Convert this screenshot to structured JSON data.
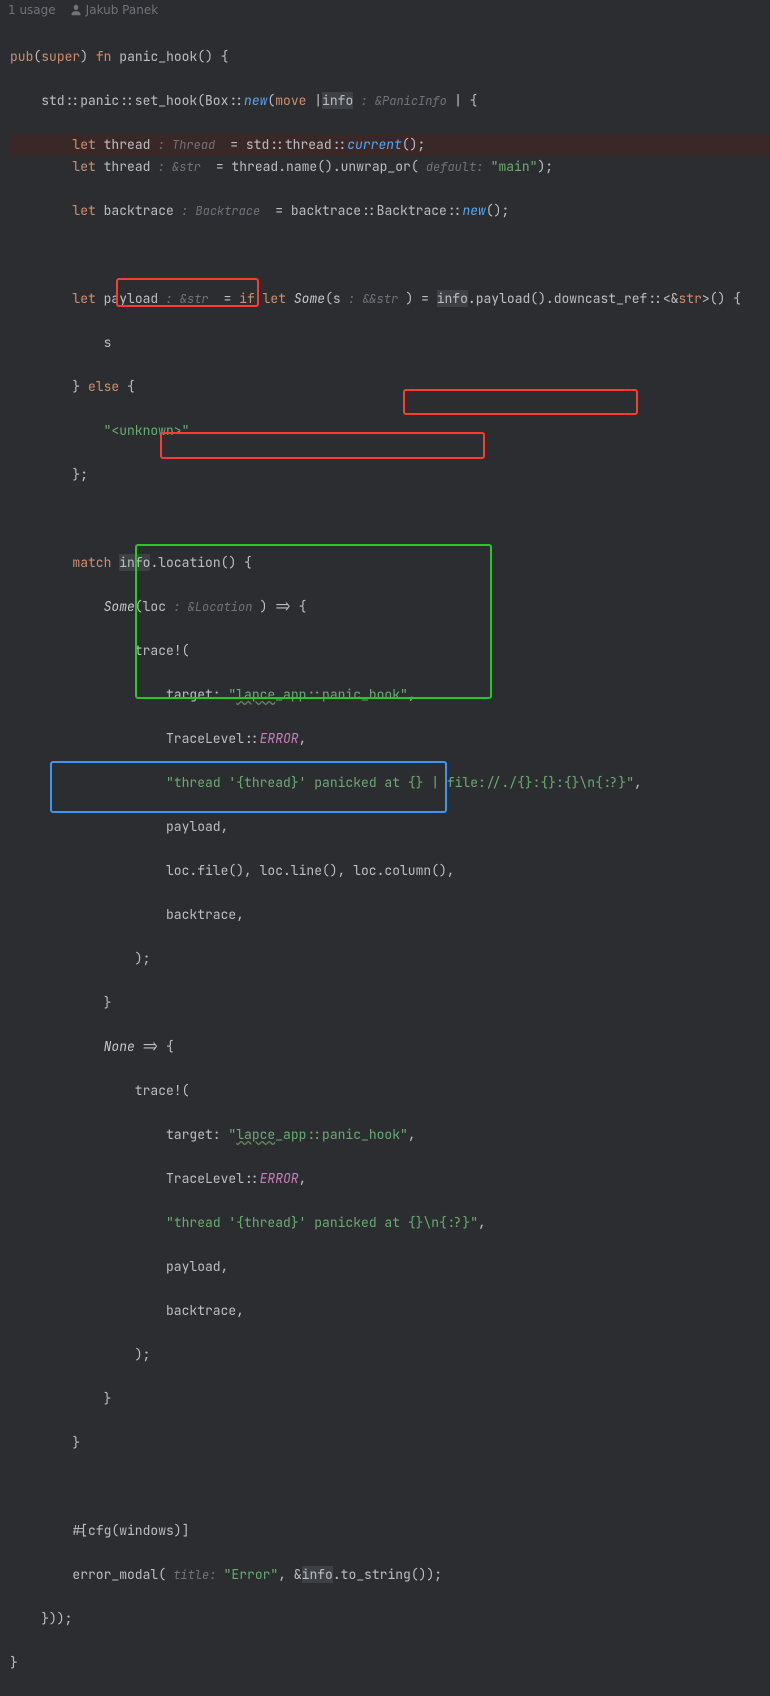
{
  "header": {
    "usages": "1 usage",
    "author": "Jakub Panek"
  },
  "code": {
    "l1_pub": "pub",
    "l1_super": "super",
    "l1_fn": "fn",
    "l1_name": "panic_hook",
    "l1_tail": "() {",
    "l2a": "    std::panic::set_hook(Box::",
    "l2new": "new",
    "l2b": "(",
    "l2move": "move",
    "l2c": " |",
    "l2info": "info",
    "l2hint": " : &PanicInfo ",
    "l2d": "| {",
    "l3let": "let",
    "l3a": " thread",
    "l3hint": " : Thread ",
    "l3b": " = std::thread::",
    "l3cur": "current",
    "l3c": "();",
    "l4let": "let",
    "l4a": " thread",
    "l4hint": " : &str ",
    "l4b": " = thread.name().unwrap_or(",
    "l4dh": " default: ",
    "l4s": "\"main\"",
    "l4c": ");",
    "l5let": "let",
    "l5a": " backtrace",
    "l5hint": " : Backtrace ",
    "l5b": " = backtrace::Backtrace::",
    "l5new": "new",
    "l5c": "();",
    "l6let": "let",
    "l6a": " payload",
    "l6hint": " : &str ",
    "l6b": " = ",
    "l6if": "if let",
    "l6some": " Some",
    "l6c": "(s",
    "l6sh": " : &&str ",
    "l6d": ") = ",
    "l6info": "info",
    "l6e": ".payload().downcast_ref::<&",
    "l6str": "str",
    "l6f": ">() {",
    "l7": "            s",
    "l8a": "        } ",
    "l8else": "else",
    "l8b": " {",
    "l9s": "\"<unknown>\"",
    "l10": "        };",
    "l12m": "match",
    "l12a": " ",
    "l12info": "info",
    "l12b": ".location() {",
    "l13some": "Some",
    "l13a": "(loc",
    "l13hint": " : &Location ",
    "l13b": ") => {",
    "l14": "                trace!(",
    "l15a": "                    target: ",
    "l15s": "\"lapce_app::panic_hook\"",
    "l15w": "lapce",
    "l15b": ",",
    "l16a": "                    TraceLevel::",
    "l16e": "ERROR",
    "l16b": ",",
    "l17s": "\"thread '{thread}' panicked at {} | file://./{}:{}:{}\\n{:?}\"",
    "l17b": ",",
    "l18": "                    payload,",
    "l19": "                    loc.file(), loc.line(), loc.column(),",
    "l20": "                    backtrace,",
    "l21": "                );",
    "l22": "            }",
    "l23none": "None",
    "l23a": " => {",
    "l24": "                trace!(",
    "l25a": "                    target: ",
    "l25s": "\"lapce_app::panic_hook\"",
    "l25b": ",",
    "l26a": "                    TraceLevel::",
    "l26e": "ERROR",
    "l26b": ",",
    "l27s": "\"thread '{thread}' panicked at {}\\n{:?}\"",
    "l27b": ",",
    "l28": "                    payload,",
    "l29": "                    backtrace,",
    "l30": "                );",
    "l31": "            }",
    "l32": "        }",
    "l34": "        #[cfg(windows)]",
    "l35a": "        error_modal(",
    "l35h": " title: ",
    "l35s": "\"Error\"",
    "l35b": ", &",
    "l35info": "info",
    "l35c": ".to_string());",
    "l36": "    }));",
    "l37": "}"
  }
}
